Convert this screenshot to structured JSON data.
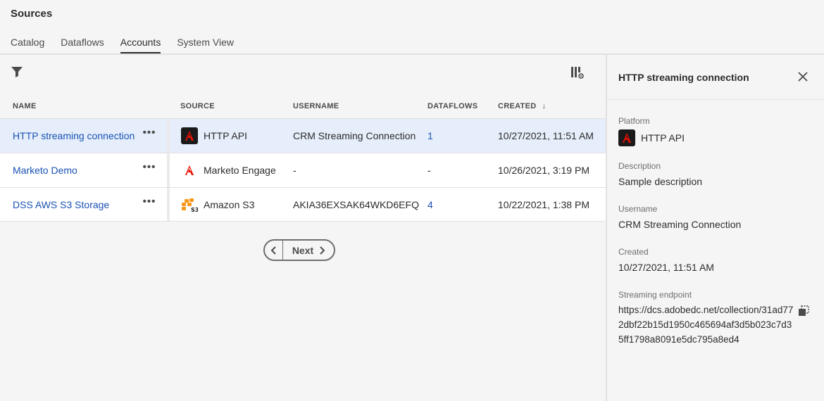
{
  "app": {
    "title": "Sources"
  },
  "tabs": [
    {
      "label": "Catalog"
    },
    {
      "label": "Dataflows"
    },
    {
      "label": "Accounts",
      "active": true
    },
    {
      "label": "System View"
    }
  ],
  "table": {
    "columns": {
      "name": "NAME",
      "source": "SOURCE",
      "username": "USERNAME",
      "dataflows": "DATAFLOWS",
      "created": "CREATED"
    },
    "sort_indicator": "↓",
    "rows": [
      {
        "name": "HTTP streaming connection",
        "more": "•••",
        "source": "HTTP API",
        "source_icon": "adobe-logo-icon",
        "username": "CRM Streaming Connection",
        "dataflows": "1",
        "created": "10/27/2021, 11:51 AM"
      },
      {
        "name": "Marketo Demo",
        "more": "•••",
        "source": "Marketo Engage",
        "source_icon": "adobe-logo-icon",
        "username": "-",
        "dataflows": "-",
        "created": "10/26/2021, 3:19 PM"
      },
      {
        "name": "DSS AWS S3 Storage",
        "more": "•••",
        "source": "Amazon S3",
        "source_icon": "amazon-s3-icon",
        "username": "AKIA36EXSAK64WKD6EFQ",
        "dataflows": "4",
        "created": "10/22/2021, 1:38 PM"
      }
    ]
  },
  "pagination": {
    "next_label": "Next"
  },
  "panel": {
    "title": "HTTP streaming connection",
    "platform_label": "Platform",
    "platform_value": "HTTP API",
    "description_label": "Description",
    "description_value": "Sample description",
    "username_label": "Username",
    "username_value": "CRM Streaming Connection",
    "created_label": "Created",
    "created_value": "10/27/2021, 11:51 AM",
    "endpoint_label": "Streaming endpoint",
    "endpoint_value": "https://dcs.adobedc.net/collection/31ad772dbf22b15d1950c465694af3d5b023c7d35ff1798a8091e5dc795a8ed4"
  },
  "colors": {
    "accent_link": "#1a52b3",
    "selected_row": "#e5eefa",
    "adobe_red": "#eb1000"
  }
}
